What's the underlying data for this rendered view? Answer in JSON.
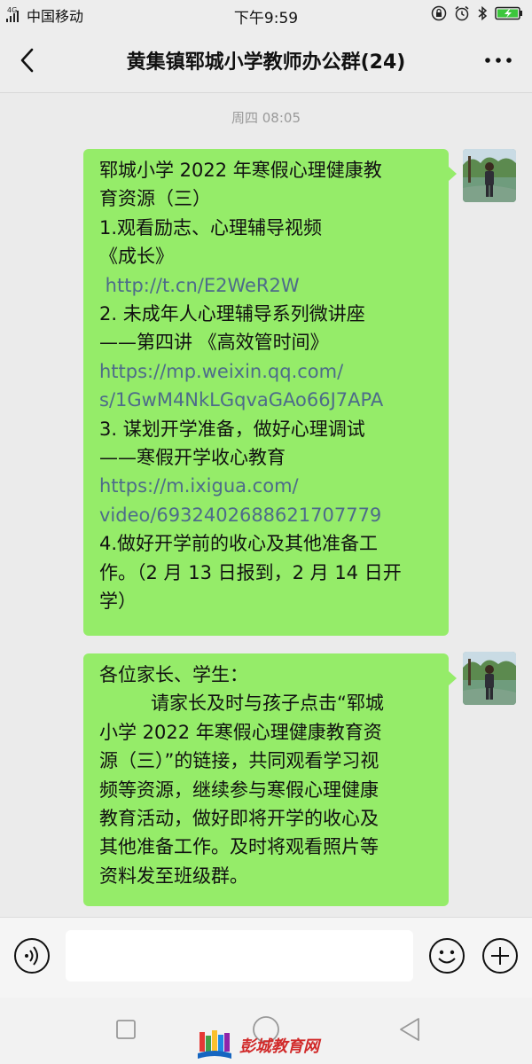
{
  "status_bar": {
    "network": "4G",
    "carrier": "中国移动",
    "time": "下午9:59",
    "icons": [
      "signal-icon",
      "lock-rotation-icon",
      "alarm-icon",
      "bluetooth-icon",
      "battery-charging-icon"
    ]
  },
  "header": {
    "title": "黄集镇郓城小学教师办公群(24)",
    "back_icon": "chevron-left-icon",
    "more_icon": "more-dots-icon"
  },
  "chat": {
    "timestamp": "周四 08:05",
    "messages": [
      {
        "lines": [
          "郓城小学 2022 年寒假心理健康教",
          "育资源（三）",
          "1.观看励志、心理辅导视频",
          "《成长》",
          " http://t.cn/E2WeR2W",
          "2. 未成年人心理辅导系列微讲座",
          "——第四讲 《高效管时间》",
          "https://mp.weixin.qq.com/",
          "s/1GwM4NkLGqvaGAo66J7APA",
          "3. 谋划开学准备，做好心理调试",
          "——寒假开学收心教育",
          "https://m.ixigua.com/",
          "video/6932402688621707779",
          "4.做好开学前的收心及其他准备工",
          "作。（2 月 13 日报到，2 月 14 日开",
          "学）"
        ]
      },
      {
        "lines": [
          "各位家长、学生：",
          "请家长及时与孩子点击“郓城",
          "小学 2022 年寒假心理健康教育资",
          "源（三）”的链接，共同观看学习视",
          "频等资源，继续参与寒假心理健康",
          "教育活动，做好即将开学的收心及",
          "其他准备工作。及时将观看照片等",
          "资料发至班级群。"
        ]
      }
    ]
  },
  "input_bar": {
    "value": "",
    "voice_icon": "voice-icon",
    "emoji_icon": "emoji-icon",
    "plus_icon": "plus-icon"
  },
  "nav_bar": {
    "icons": [
      "square-recents-icon",
      "circle-home-icon",
      "triangle-back-icon"
    ]
  },
  "watermark": {
    "text": "彭城教育网"
  },
  "colors": {
    "bubble": "#95ec69",
    "link": "#4d6b8a",
    "background": "#ebebeb",
    "header": "#ededed",
    "watermark": "#d12a2a"
  }
}
